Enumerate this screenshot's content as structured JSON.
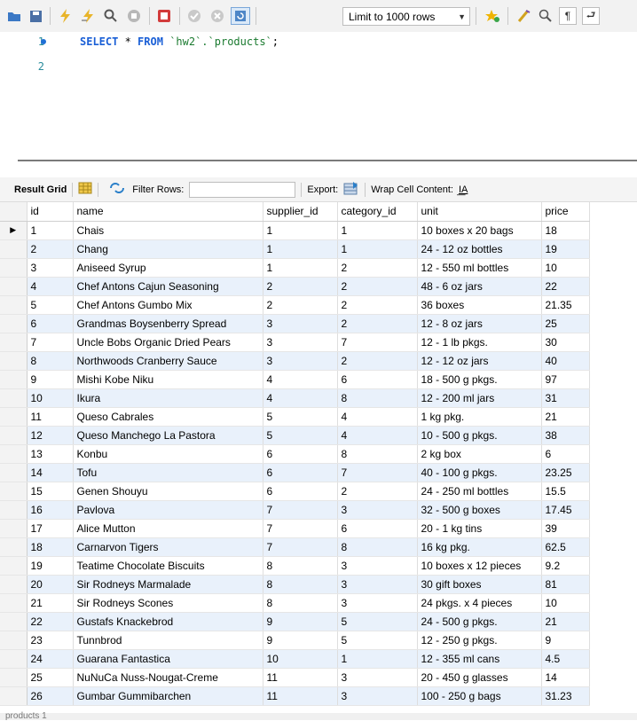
{
  "toolbar": {
    "limit_label": "Limit to 1000 rows",
    "icons": [
      "folder-icon",
      "save-icon",
      "execute-icon",
      "execute-selection-icon",
      "explain-icon",
      "stop-icon",
      "toggle-continue-icon",
      "commit-icon",
      "rollback-icon",
      "autocommit-icon",
      "bookmark-star-icon",
      "beautify-icon",
      "find-icon",
      "invisible-chars-icon",
      "word-wrap-icon"
    ]
  },
  "editor": {
    "lines": [
      {
        "num": "1",
        "code": "SELECT * FROM `hw2`.`products`;"
      },
      {
        "num": "2",
        "code": ""
      }
    ]
  },
  "result_bar": {
    "grid_label": "Result Grid",
    "filter_label": "Filter Rows:",
    "export_label": "Export:",
    "wrap_label": "Wrap Cell Content:"
  },
  "grid": {
    "columns": [
      "id",
      "name",
      "supplier_id",
      "category_id",
      "unit",
      "price"
    ],
    "rows": [
      [
        "1",
        "Chais",
        "1",
        "1",
        "10 boxes x 20 bags",
        "18"
      ],
      [
        "2",
        "Chang",
        "1",
        "1",
        "24 - 12 oz bottles",
        "19"
      ],
      [
        "3",
        "Aniseed Syrup",
        "1",
        "2",
        "12 - 550 ml bottles",
        "10"
      ],
      [
        "4",
        "Chef Antons Cajun Seasoning",
        "2",
        "2",
        "48 - 6 oz jars",
        "22"
      ],
      [
        "5",
        "Chef Antons Gumbo Mix",
        "2",
        "2",
        "36 boxes",
        "21.35"
      ],
      [
        "6",
        "Grandmas Boysenberry Spread",
        "3",
        "2",
        "12 - 8 oz jars",
        "25"
      ],
      [
        "7",
        "Uncle Bobs Organic Dried Pears",
        "3",
        "7",
        "12 - 1 lb pkgs.",
        "30"
      ],
      [
        "8",
        "Northwoods Cranberry Sauce",
        "3",
        "2",
        "12 - 12 oz jars",
        "40"
      ],
      [
        "9",
        "Mishi Kobe Niku",
        "4",
        "6",
        "18 - 500 g pkgs.",
        "97"
      ],
      [
        "10",
        "Ikura",
        "4",
        "8",
        "12 - 200 ml jars",
        "31"
      ],
      [
        "11",
        "Queso Cabrales",
        "5",
        "4",
        "1 kg pkg.",
        "21"
      ],
      [
        "12",
        "Queso Manchego La Pastora",
        "5",
        "4",
        "10 - 500 g pkgs.",
        "38"
      ],
      [
        "13",
        "Konbu",
        "6",
        "8",
        "2 kg box",
        "6"
      ],
      [
        "14",
        "Tofu",
        "6",
        "7",
        "40 - 100 g pkgs.",
        "23.25"
      ],
      [
        "15",
        "Genen Shouyu",
        "6",
        "2",
        "24 - 250 ml bottles",
        "15.5"
      ],
      [
        "16",
        "Pavlova",
        "7",
        "3",
        "32 - 500 g boxes",
        "17.45"
      ],
      [
        "17",
        "Alice Mutton",
        "7",
        "6",
        "20 - 1 kg tins",
        "39"
      ],
      [
        "18",
        "Carnarvon Tigers",
        "7",
        "8",
        "16 kg pkg.",
        "62.5"
      ],
      [
        "19",
        "Teatime Chocolate Biscuits",
        "8",
        "3",
        "10 boxes x 12 pieces",
        "9.2"
      ],
      [
        "20",
        "Sir Rodneys Marmalade",
        "8",
        "3",
        "30 gift boxes",
        "81"
      ],
      [
        "21",
        "Sir Rodneys Scones",
        "8",
        "3",
        "24 pkgs. x 4 pieces",
        "10"
      ],
      [
        "22",
        "Gustafs Knackebrod",
        "9",
        "5",
        "24 - 500 g pkgs.",
        "21"
      ],
      [
        "23",
        "Tunnbrod",
        "9",
        "5",
        "12 - 250 g pkgs.",
        "9"
      ],
      [
        "24",
        "Guarana Fantastica",
        "10",
        "1",
        "12 - 355 ml cans",
        "4.5"
      ],
      [
        "25",
        "NuNuCa Nuss-Nougat-Creme",
        "11",
        "3",
        "20 - 450 g glasses",
        "14"
      ],
      [
        "26",
        "Gumbar Gummibarchen",
        "11",
        "3",
        "100 - 250 g bags",
        "31.23"
      ]
    ]
  },
  "status": {
    "tab": "products 1"
  }
}
